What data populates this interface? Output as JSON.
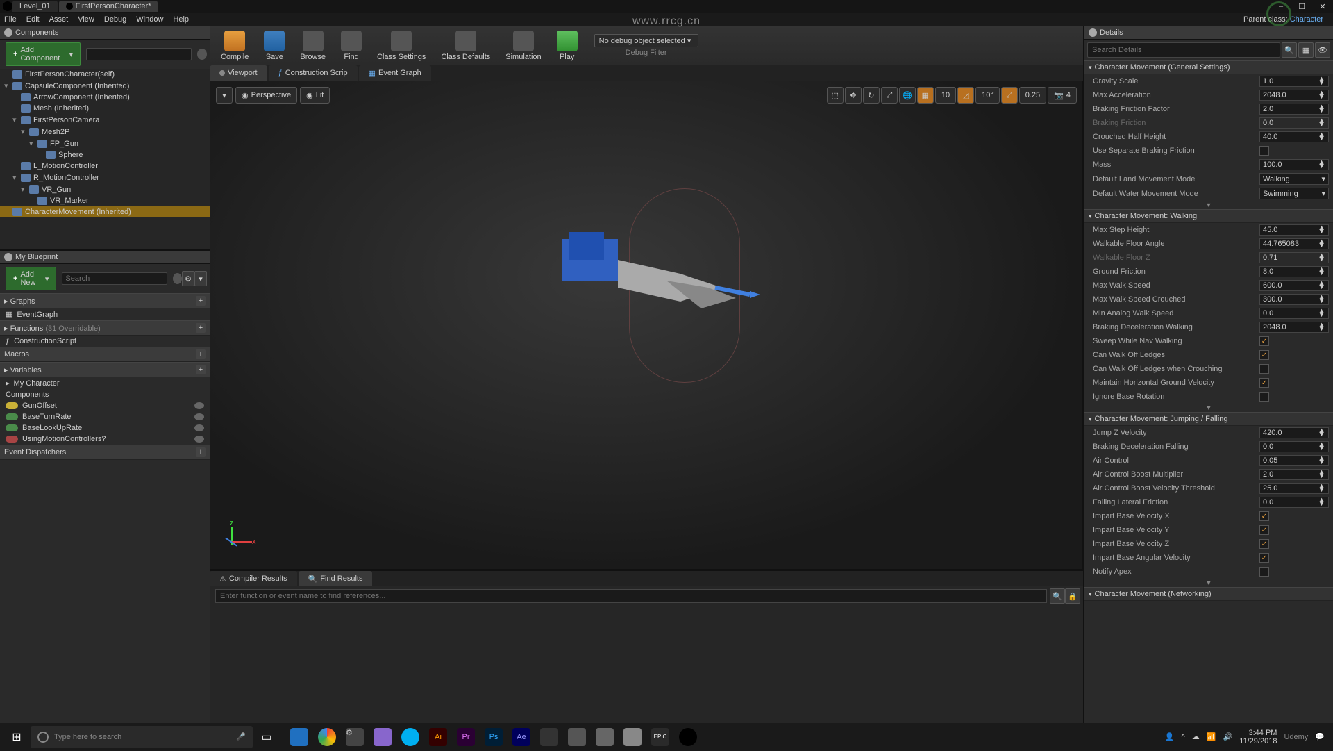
{
  "tabs": {
    "level": "Level_01",
    "bp": "FirstPersonCharacter*"
  },
  "menu": [
    "File",
    "Edit",
    "Asset",
    "View",
    "Debug",
    "Window",
    "Help"
  ],
  "watermark": "www.rrcg.cn",
  "components": {
    "title": "Components",
    "add": "Add Component",
    "items": [
      {
        "label": "FirstPersonCharacter(self)",
        "indent": 0
      },
      {
        "label": "CapsuleComponent (Inherited)",
        "indent": 0,
        "arr": "▾"
      },
      {
        "label": "ArrowComponent (Inherited)",
        "indent": 1
      },
      {
        "label": "Mesh (Inherited)",
        "indent": 1
      },
      {
        "label": "FirstPersonCamera",
        "indent": 1,
        "arr": "▾"
      },
      {
        "label": "Mesh2P",
        "indent": 2,
        "arr": "▾"
      },
      {
        "label": "FP_Gun",
        "indent": 3,
        "arr": "▾"
      },
      {
        "label": "Sphere",
        "indent": 4
      },
      {
        "label": "L_MotionController",
        "indent": 1
      },
      {
        "label": "R_MotionController",
        "indent": 1,
        "arr": "▾"
      },
      {
        "label": "VR_Gun",
        "indent": 2,
        "arr": "▾"
      },
      {
        "label": "VR_Marker",
        "indent": 3
      },
      {
        "label": "CharacterMovement (Inherited)",
        "indent": 0,
        "sel": true
      }
    ]
  },
  "mybp": {
    "title": "My Blueprint",
    "add": "Add New",
    "search": "Search",
    "graphs": "Graphs",
    "eventgraph": "EventGraph",
    "functions": "Functions",
    "funcnote": "(31 Overridable)",
    "construction": "ConstructionScript",
    "macros": "Macros",
    "variables": "Variables",
    "mychar": "My Character",
    "componentscat": "Components",
    "vars": [
      {
        "label": "GunOffset",
        "pill": "pill-yellow"
      },
      {
        "label": "BaseTurnRate",
        "pill": "pill-green"
      },
      {
        "label": "BaseLookUpRate",
        "pill": "pill-green"
      },
      {
        "label": "UsingMotionControllers?",
        "pill": "pill-red"
      }
    ],
    "dispatchers": "Event Dispatchers"
  },
  "toolbar": {
    "compile": "Compile",
    "save": "Save",
    "browse": "Browse",
    "find": "Find",
    "classsettings": "Class Settings",
    "classdefaults": "Class Defaults",
    "simulation": "Simulation",
    "play": "Play",
    "debugsel": "No debug object selected",
    "debugfilter": "Debug Filter",
    "parentlabel": "Parent class:",
    "parentclass": "Character"
  },
  "vptabs": {
    "viewport": "Viewport",
    "construction": "Construction Scrip",
    "eventgraph": "Event Graph"
  },
  "vpctrl": {
    "perspective": "Perspective",
    "lit": "Lit",
    "v10": "10",
    "a10": "10°",
    "s025": "0.25",
    "cam": "4"
  },
  "results": {
    "compiler": "Compiler Results",
    "find": "Find Results",
    "placeholder": "Enter function or event name to find references..."
  },
  "details": {
    "title": "Details",
    "search": "Search Details",
    "sections": [
      {
        "title": "Character Movement (General Settings)",
        "props": [
          {
            "label": "Gravity Scale",
            "val": "1.0"
          },
          {
            "label": "Max Acceleration",
            "val": "2048.0"
          },
          {
            "label": "Braking Friction Factor",
            "val": "2.0"
          },
          {
            "label": "Braking Friction",
            "val": "0.0",
            "dim": true
          },
          {
            "label": "Crouched Half Height",
            "val": "40.0"
          },
          {
            "label": "Use Separate Braking Friction",
            "check": false
          },
          {
            "label": "Mass",
            "val": "100.0"
          },
          {
            "label": "Default Land Movement Mode",
            "val": "Walking",
            "combo": true
          },
          {
            "label": "Default Water Movement Mode",
            "val": "Swimming",
            "combo": true
          }
        ],
        "expand": true
      },
      {
        "title": "Character Movement: Walking",
        "props": [
          {
            "label": "Max Step Height",
            "val": "45.0"
          },
          {
            "label": "Walkable Floor Angle",
            "val": "44.765083"
          },
          {
            "label": "Walkable Floor Z",
            "val": "0.71",
            "dim": true
          },
          {
            "label": "Ground Friction",
            "val": "8.0"
          },
          {
            "label": "Max Walk Speed",
            "val": "600.0"
          },
          {
            "label": "Max Walk Speed Crouched",
            "val": "300.0"
          },
          {
            "label": "Min Analog Walk Speed",
            "val": "0.0"
          },
          {
            "label": "Braking Deceleration Walking",
            "val": "2048.0"
          },
          {
            "label": "Sweep While Nav Walking",
            "check": true
          },
          {
            "label": "Can Walk Off Ledges",
            "check": true
          },
          {
            "label": "Can Walk Off Ledges when Crouching",
            "check": false
          },
          {
            "label": "Maintain Horizontal Ground Velocity",
            "check": true
          },
          {
            "label": "Ignore Base Rotation",
            "check": false
          }
        ],
        "expand": true
      },
      {
        "title": "Character Movement: Jumping / Falling",
        "props": [
          {
            "label": "Jump Z Velocity",
            "val": "420.0"
          },
          {
            "label": "Braking Deceleration Falling",
            "val": "0.0"
          },
          {
            "label": "Air Control",
            "val": "0.05"
          },
          {
            "label": "Air Control Boost Multiplier",
            "val": "2.0"
          },
          {
            "label": "Air Control Boost Velocity Threshold",
            "val": "25.0"
          },
          {
            "label": "Falling Lateral Friction",
            "val": "0.0"
          },
          {
            "label": "Impart Base Velocity X",
            "check": true
          },
          {
            "label": "Impart Base Velocity Y",
            "check": true
          },
          {
            "label": "Impart Base Velocity Z",
            "check": true
          },
          {
            "label": "Impart Base Angular Velocity",
            "check": true
          },
          {
            "label": "Notify Apex",
            "check": false
          }
        ],
        "expand": true
      },
      {
        "title": "Character Movement (Networking)",
        "props": []
      }
    ]
  },
  "taskbar": {
    "search": "Type here to search",
    "time": "3:44 PM",
    "date": "11/29/2018",
    "udemy": "Udemy"
  }
}
